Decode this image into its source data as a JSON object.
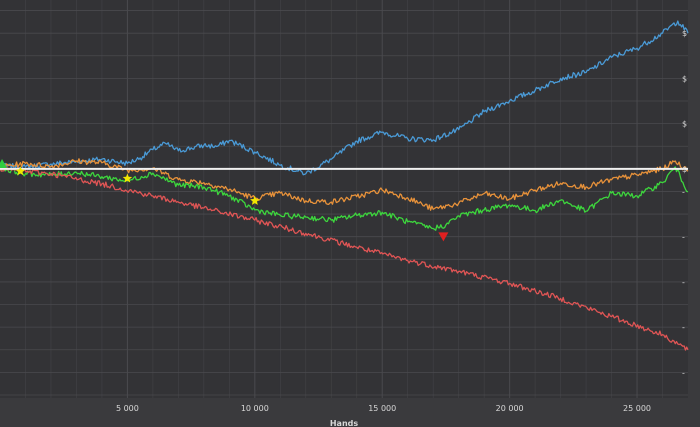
{
  "colors": {
    "background": "#3a3a3d",
    "plot_background": "#333336",
    "grid": "#4a4a4e",
    "text": "#d8d8d8",
    "zero_line": "#f0f0f0"
  },
  "chart_data": {
    "type": "line",
    "title": "",
    "xlabel": "Hands",
    "ylabel": "",
    "xlim": [
      0,
      27000
    ],
    "ylim": [
      -38,
      28
    ],
    "grid": true,
    "legend": "none",
    "x_ticks": [
      {
        "value": 5000,
        "label": "5 000"
      },
      {
        "value": 10000,
        "label": "10 000"
      },
      {
        "value": 15000,
        "label": "15 000"
      },
      {
        "value": 20000,
        "label": "20 000"
      },
      {
        "value": 25000,
        "label": "25 000"
      }
    ],
    "y_ticks": [
      {
        "value": 22.5,
        "label": "$"
      },
      {
        "value": 15,
        "label": "$"
      },
      {
        "value": 7.5,
        "label": "$"
      },
      {
        "value": 0,
        "label": "$"
      },
      {
        "value": -3.75,
        "label": "-"
      },
      {
        "value": -11.25,
        "label": "-"
      },
      {
        "value": -18.75,
        "label": "-"
      },
      {
        "value": -26.25,
        "label": "-"
      },
      {
        "value": -33.75,
        "label": "-"
      }
    ],
    "series": [
      {
        "color": "#4a9ad6",
        "x": [
          0,
          1000,
          2000,
          3000,
          4000,
          5000,
          5500,
          6000,
          6500,
          7000,
          8000,
          8500,
          9000,
          10000,
          11000,
          12000,
          13000,
          14000,
          15000,
          16000,
          17000,
          18000,
          19000,
          20000,
          21000,
          22000,
          23000,
          24000,
          25000,
          26000,
          26600,
          27000
        ],
        "y": [
          0.5,
          0.3,
          0.8,
          1.2,
          1.6,
          0.9,
          1.8,
          3.2,
          4.2,
          3.0,
          3.9,
          3.7,
          4.7,
          2.8,
          0.6,
          -0.8,
          1.6,
          4.6,
          6.1,
          5.0,
          4.8,
          6.5,
          9.5,
          11.3,
          13.0,
          15.0,
          16.0,
          18.5,
          20.0,
          22.5,
          24.5,
          22.5
        ]
      },
      {
        "color": "#e8923a",
        "x": [
          0,
          1000,
          2000,
          3000,
          4000,
          5000,
          6000,
          7000,
          8000,
          9000,
          10000,
          11000,
          12000,
          13000,
          14000,
          15000,
          16000,
          17000,
          18000,
          19000,
          20000,
          21000,
          22000,
          23000,
          24000,
          25000,
          26000,
          26500,
          27000
        ],
        "y": [
          0.3,
          0.9,
          0.4,
          1.3,
          1.0,
          -0.2,
          0.1,
          -1.8,
          -2.3,
          -3.4,
          -4.9,
          -4.0,
          -5.3,
          -5.5,
          -4.6,
          -3.5,
          -4.8,
          -6.7,
          -5.7,
          -4.1,
          -5.0,
          -3.5,
          -2.4,
          -3.0,
          -1.8,
          -1.0,
          0.0,
          1.3,
          -0.4
        ]
      },
      {
        "color": "#3dd63d",
        "x": [
          0,
          1000,
          2000,
          3000,
          4000,
          5000,
          6000,
          7000,
          8000,
          9000,
          10000,
          11000,
          12000,
          13000,
          14000,
          15000,
          16000,
          17000,
          17500,
          18000,
          19000,
          20000,
          21000,
          22000,
          23000,
          24000,
          25000,
          26000,
          26500,
          27000
        ],
        "y": [
          0.1,
          -0.8,
          -1.0,
          -0.6,
          -1.3,
          -2.0,
          -0.7,
          -2.7,
          -3.0,
          -4.5,
          -6.8,
          -7.7,
          -8.0,
          -8.5,
          -7.7,
          -7.2,
          -8.8,
          -9.9,
          -9.3,
          -7.8,
          -6.8,
          -6.0,
          -6.9,
          -5.2,
          -7.0,
          -4.0,
          -4.5,
          -2.3,
          0.3,
          -3.8
        ]
      },
      {
        "color": "#e05555",
        "x": [
          0,
          2000,
          4000,
          6000,
          8000,
          10000,
          12000,
          14000,
          16000,
          18000,
          20000,
          22000,
          24000,
          26000,
          27000
        ],
        "y": [
          0,
          -0.8,
          -2.5,
          -4.5,
          -6.5,
          -8.5,
          -10.7,
          -13.0,
          -15.2,
          -17.0,
          -19.0,
          -21.5,
          -24.5,
          -27.5,
          -30.0
        ]
      }
    ],
    "markers": [
      {
        "shape": "triangle-up",
        "color": "#2ecc40",
        "x": 80,
        "y": 0.8
      },
      {
        "shape": "star",
        "color": "#f2e600",
        "x": 800,
        "y": -0.4
      },
      {
        "shape": "star",
        "color": "#f2e600",
        "x": 5000,
        "y": -1.6
      },
      {
        "shape": "star",
        "color": "#f2e600",
        "x": 10000,
        "y": -5.3
      },
      {
        "shape": "triangle-down",
        "color": "#e02020",
        "x": 17400,
        "y": -11.2
      }
    ]
  }
}
